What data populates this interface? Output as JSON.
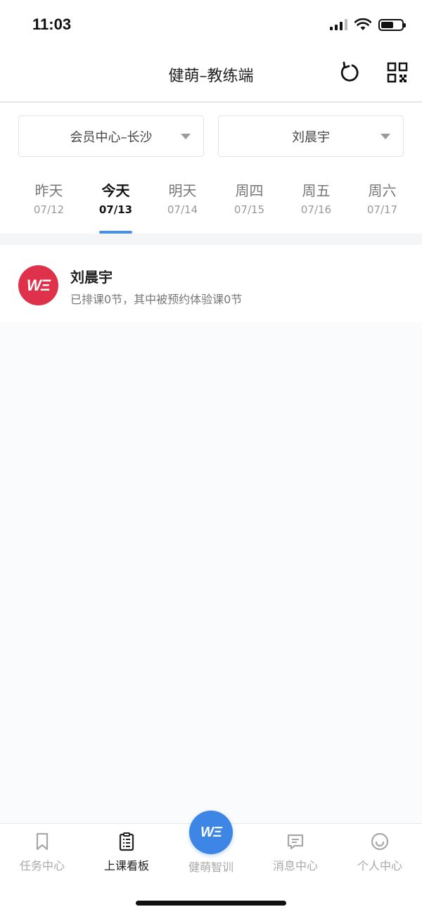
{
  "status_bar": {
    "time": "11:03"
  },
  "nav": {
    "title": "健萌–教练端"
  },
  "selectors": {
    "center": "会员中心–长沙",
    "coach": "刘晨宇"
  },
  "day_tabs": [
    {
      "label": "昨天",
      "date": "07/12"
    },
    {
      "label": "今天",
      "date": "07/13"
    },
    {
      "label": "明天",
      "date": "07/14"
    },
    {
      "label": "周四",
      "date": "07/15"
    },
    {
      "label": "周五",
      "date": "07/16"
    },
    {
      "label": "周六",
      "date": "07/17"
    }
  ],
  "active_day": "今天",
  "coach_card": {
    "avatar_text": "WΞ",
    "name": "刘晨宇",
    "summary": "已排课0节，其中被预约体验课0节"
  },
  "tab_bar": {
    "items": [
      {
        "label": "任务中心",
        "icon": "bookmark-icon"
      },
      {
        "label": "上课看板",
        "icon": "clipboard-icon"
      },
      {
        "label": "健萌智训",
        "icon": "brand-logo-icon",
        "logo_text": "WΞ"
      },
      {
        "label": "消息中心",
        "icon": "chat-bubble-icon"
      },
      {
        "label": "个人中心",
        "icon": "smile-icon"
      }
    ],
    "active": "上课看板"
  },
  "colors": {
    "accent": "#4a90e2",
    "fab": "#3d86e6",
    "avatar": "#e0314b"
  }
}
